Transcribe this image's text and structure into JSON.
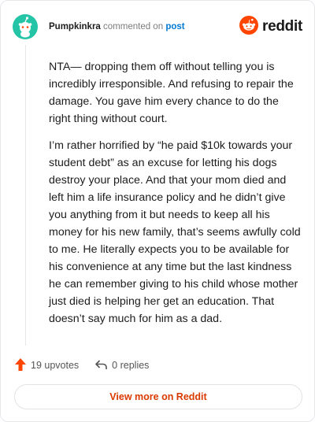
{
  "header": {
    "username": "Pumpkinkra",
    "commented_text": "commented on",
    "post_link": "post",
    "brand": "reddit"
  },
  "comment": {
    "paragraphs": [
      "NTA— dropping them off without telling you is incredibly irresponsible. And refusing to repair the damage. You gave him every chance to do the right thing without court.",
      "I’m rather horrified by “he paid $10k towards your student debt” as an excuse for letting his dogs destroy your place. And that your mom died and left him a life insurance policy and he didn’t give you anything from it but needs to keep all his money for his new family, that’s seems awfully cold to me. He literally expects you to be available for his convenience at any time but the last kindness he can remember giving to his child whose mother just died is helping her get an education. That doesn’t say much for him as a dad."
    ]
  },
  "actions": {
    "upvotes_label": "19 upvotes",
    "replies_label": "0 replies"
  },
  "footer": {
    "view_more_label": "View more on Reddit"
  },
  "colors": {
    "brand_orange": "#ff4500",
    "avatar_teal": "#25c4a6",
    "link_blue": "#0079d3",
    "view_more_text": "#d93a00"
  },
  "icons": {
    "avatar": "snoo-avatar-icon",
    "logo": "reddit-logo-icon",
    "upvote": "upvote-arrow-icon",
    "reply": "reply-arrow-icon"
  }
}
